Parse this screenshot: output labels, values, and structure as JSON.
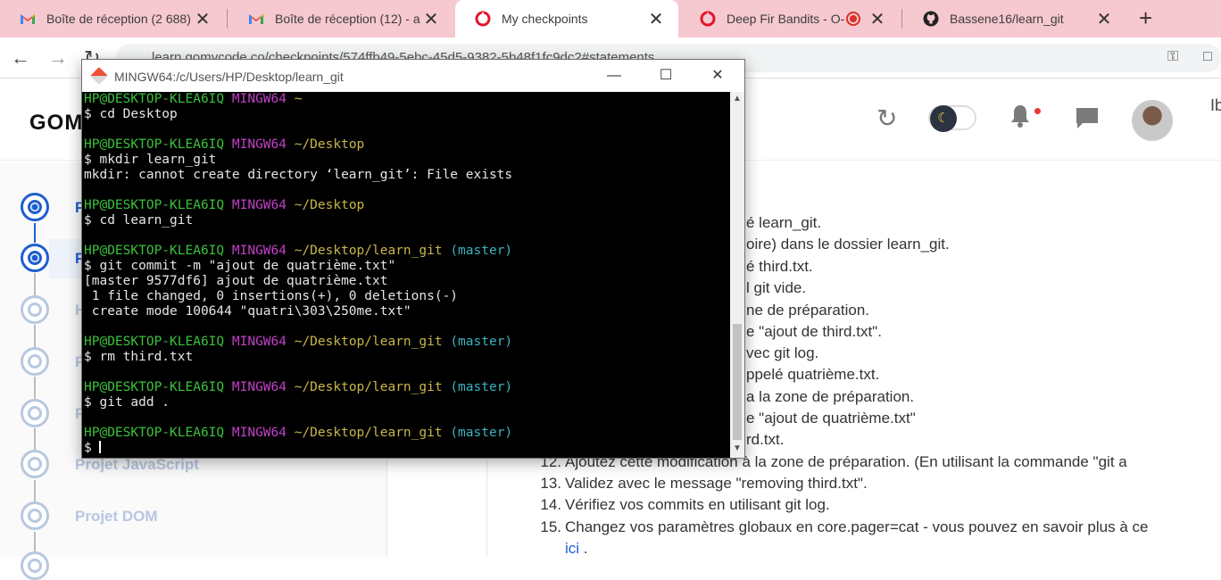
{
  "browser": {
    "tabs": [
      {
        "title": "Boîte de réception (2 688)",
        "icon": "gmail-icon"
      },
      {
        "title": "Boîte de réception (12) - a",
        "icon": "gmail-icon"
      },
      {
        "title": "My checkpoints",
        "icon": "gomycode-icon",
        "active": true
      },
      {
        "title": "Deep Fir Bandits - O-",
        "icon": "gomycode-icon"
      },
      {
        "title": "Bassene16/learn_git",
        "icon": "github-icon"
      }
    ],
    "close_glyph": "✕",
    "new_tab_glyph": "+",
    "url": "learn.gomycode.co/checkpoints/574ffb49-5ebc-45d5-9382-5b48f1fc9dc2#statements"
  },
  "header": {
    "logo": "GOM",
    "user_initial": "Ib"
  },
  "sidebar": {
    "items": [
      {
        "label": "P",
        "active": true
      },
      {
        "label": "P",
        "active": true
      },
      {
        "label": "H",
        "active": false
      },
      {
        "label": "P",
        "active": false
      },
      {
        "label": "P",
        "active": false
      },
      {
        "label": "Projet JavaScript",
        "active": false
      },
      {
        "label": "Projet DOM",
        "active": false
      }
    ]
  },
  "content": {
    "partial_lines": [
      "é learn_git.",
      "oire) dans le dossier learn_git.",
      "é third.txt.",
      "l git vide.",
      "ne de préparation.",
      "e \"ajout de third.txt\".",
      "vec git log.",
      "ppelé quatrième.txt.",
      "a la zone de préparation.",
      "e \"ajout de quatrième.txt\"",
      "rd.txt."
    ],
    "items": [
      {
        "num": "12.",
        "text": "Ajoutez cette modification à la zone de préparation. (En utilisant la commande \"git a"
      },
      {
        "num": "13.",
        "text": "Validez avec le message \"removing third.txt\"."
      },
      {
        "num": "14.",
        "text": "Vérifiez vos commits en utilisant git log."
      },
      {
        "num": "15.",
        "text": "Changez vos paramètres globaux en core.pager=cat - vous pouvez en savoir plus à ce"
      }
    ],
    "link_text": "ici",
    "link_after": " ."
  },
  "terminal": {
    "title": "MINGW64:/c/Users/HP/Desktop/learn_git",
    "lines": [
      [
        {
          "t": "HP@DESKTOP-KLEA6IQ ",
          "c": "green"
        },
        {
          "t": "MINGW64 ",
          "c": "mag"
        },
        {
          "t": "~",
          "c": "yel"
        }
      ],
      [
        {
          "t": "$ cd Desktop",
          "c": ""
        }
      ],
      [
        {
          "t": "",
          "c": ""
        }
      ],
      [
        {
          "t": "HP@DESKTOP-KLEA6IQ ",
          "c": "green"
        },
        {
          "t": "MINGW64 ",
          "c": "mag"
        },
        {
          "t": "~/Desktop",
          "c": "yel"
        }
      ],
      [
        {
          "t": "$ mkdir learn_git",
          "c": ""
        }
      ],
      [
        {
          "t": "mkdir: cannot create directory ‘learn_git’: File exists",
          "c": ""
        }
      ],
      [
        {
          "t": "",
          "c": ""
        }
      ],
      [
        {
          "t": "HP@DESKTOP-KLEA6IQ ",
          "c": "green"
        },
        {
          "t": "MINGW64 ",
          "c": "mag"
        },
        {
          "t": "~/Desktop",
          "c": "yel"
        }
      ],
      [
        {
          "t": "$ cd learn_git",
          "c": ""
        }
      ],
      [
        {
          "t": "",
          "c": ""
        }
      ],
      [
        {
          "t": "HP@DESKTOP-KLEA6IQ ",
          "c": "green"
        },
        {
          "t": "MINGW64 ",
          "c": "mag"
        },
        {
          "t": "~/Desktop/learn_git ",
          "c": "yel"
        },
        {
          "t": "(master)",
          "c": "cyan"
        }
      ],
      [
        {
          "t": "$ git commit -m \"ajout de quatrième.txt\"",
          "c": ""
        }
      ],
      [
        {
          "t": "[master 9577df6] ajout de quatrième.txt",
          "c": ""
        }
      ],
      [
        {
          "t": " 1 file changed, 0 insertions(+), 0 deletions(-)",
          "c": ""
        }
      ],
      [
        {
          "t": " create mode 100644 \"quatri\\303\\250me.txt\"",
          "c": ""
        }
      ],
      [
        {
          "t": "",
          "c": ""
        }
      ],
      [
        {
          "t": "HP@DESKTOP-KLEA6IQ ",
          "c": "green"
        },
        {
          "t": "MINGW64 ",
          "c": "mag"
        },
        {
          "t": "~/Desktop/learn_git ",
          "c": "yel"
        },
        {
          "t": "(master)",
          "c": "cyan"
        }
      ],
      [
        {
          "t": "$ rm third.txt",
          "c": ""
        }
      ],
      [
        {
          "t": "",
          "c": ""
        }
      ],
      [
        {
          "t": "HP@DESKTOP-KLEA6IQ ",
          "c": "green"
        },
        {
          "t": "MINGW64 ",
          "c": "mag"
        },
        {
          "t": "~/Desktop/learn_git ",
          "c": "yel"
        },
        {
          "t": "(master)",
          "c": "cyan"
        }
      ],
      [
        {
          "t": "$ git add .",
          "c": ""
        }
      ],
      [
        {
          "t": "",
          "c": ""
        }
      ],
      [
        {
          "t": "HP@DESKTOP-KLEA6IQ ",
          "c": "green"
        },
        {
          "t": "MINGW64 ",
          "c": "mag"
        },
        {
          "t": "~/Desktop/learn_git ",
          "c": "yel"
        },
        {
          "t": "(master)",
          "c": "cyan"
        }
      ],
      [
        {
          "t": "$ ",
          "c": "",
          "cursor": true
        }
      ]
    ]
  },
  "colors": {
    "tabbar": "#f6c8cf",
    "accent": "#1e5fcf",
    "term_green": "#3bc13b",
    "term_magenta": "#c33fc9",
    "term_yellow": "#c9b64a",
    "term_cyan": "#3ab3c0"
  }
}
